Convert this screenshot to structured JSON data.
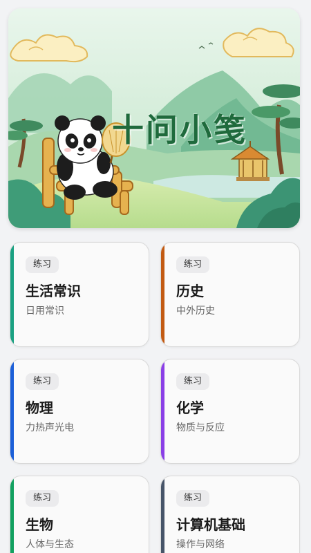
{
  "banner": {
    "title": "十问小笺",
    "image": "panda-on-bamboo-chair-landscape"
  },
  "categories": [
    {
      "tag": "练习",
      "title": "生活常识",
      "subtitle": "日用常识",
      "accent": "#1aa182"
    },
    {
      "tag": "练习",
      "title": "历史",
      "subtitle": "中外历史",
      "accent": "#c25a12"
    },
    {
      "tag": "练习",
      "title": "物理",
      "subtitle": "力热声光电",
      "accent": "#1b5fd8"
    },
    {
      "tag": "练习",
      "title": "化学",
      "subtitle": "物质与反应",
      "accent": "#8a3fe6"
    },
    {
      "tag": "练习",
      "title": "生物",
      "subtitle": "人体与生态",
      "accent": "#12a160"
    },
    {
      "tag": "练习",
      "title": "计算机基础",
      "subtitle": "操作与网络",
      "accent": "#475569"
    }
  ]
}
